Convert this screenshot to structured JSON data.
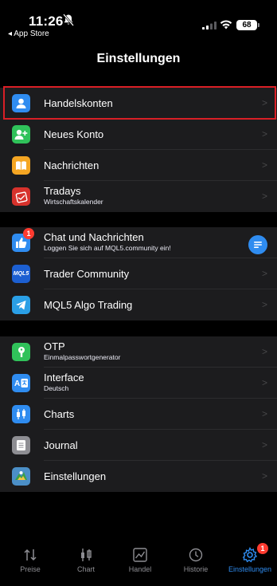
{
  "status_bar": {
    "time": "11:26",
    "back_app": "◂ App Store",
    "battery": "68"
  },
  "nav": {
    "title": "Einstellungen"
  },
  "groups": [
    {
      "items": [
        {
          "label": "Handelskonten",
          "icon": "person-icon",
          "color": "#2f8cf0"
        },
        {
          "label": "Neues Konto",
          "icon": "add-person-icon",
          "color": "#30c25a"
        },
        {
          "label": "Nachrichten",
          "icon": "book-icon",
          "color": "#f5a623"
        },
        {
          "label": "Tradays",
          "sub": "Wirtschaftskalender",
          "icon": "calendar-icon",
          "color": "#d7322c"
        }
      ]
    },
    {
      "items": [
        {
          "label": "Chat und Nachrichten",
          "sub": "Loggen Sie sich auf MQL5.community ein!",
          "icon": "thumbs-up-icon",
          "color": "#2f8cf0",
          "badge": "1"
        },
        {
          "label": "Trader Community",
          "icon": "mql5-logo-icon",
          "color": "#1c5fd1",
          "logo_text": "MQL5"
        },
        {
          "label": "MQL5 Algo Trading",
          "icon": "telegram-icon",
          "color": "#2a9fe6"
        }
      ]
    },
    {
      "items": [
        {
          "label": "OTP",
          "sub": "Einmalpasswortgenerator",
          "icon": "key-icon",
          "color": "#30c25a"
        },
        {
          "label": "Interface",
          "sub": "Deutsch",
          "icon": "translate-icon",
          "color": "#2f8cf0"
        },
        {
          "label": "Charts",
          "icon": "candlestick-icon",
          "color": "#2f8cf0"
        },
        {
          "label": "Journal",
          "icon": "journal-icon",
          "color": "#8e8e93"
        },
        {
          "label": "Einstellungen",
          "icon": "metatrader-icon",
          "color": "#4b8fc7"
        }
      ]
    }
  ],
  "tabs": [
    {
      "label": "Preise",
      "icon": "quotes-icon"
    },
    {
      "label": "Chart",
      "icon": "chart-icon"
    },
    {
      "label": "Handel",
      "icon": "trade-icon"
    },
    {
      "label": "Historie",
      "icon": "history-icon"
    },
    {
      "label": "Einstellungen",
      "icon": "settings-gear-icon",
      "active": true,
      "badge": "1"
    }
  ],
  "colors": {
    "accent": "#2f8cf0",
    "highlight": "#d91f26",
    "badge": "#ff3b30"
  }
}
